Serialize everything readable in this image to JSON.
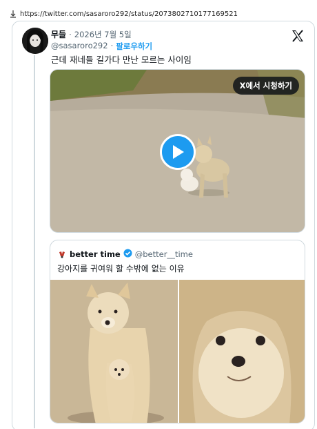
{
  "browser": {
    "url": "https://twitter.com/sasaroro292/status/2073802710177169521"
  },
  "tweet": {
    "display_name": "무들",
    "date": "2026년 7월 5일",
    "handle": "@sasaroro292",
    "follow_label": "팔로우하기",
    "text": "근데 재네들 길가다 만난 모르는 사이임",
    "watch_label": "X에서 시청하기"
  },
  "quote": {
    "display_name": "better time",
    "handle": "@better__time",
    "text": "강아지를 귀여워 할 수밖에 없는 이유"
  },
  "colors": {
    "accent": "#1d9bf0",
    "text": "#0f1419",
    "muted": "#536471",
    "border": "#cfd9de"
  },
  "icons": [
    "download-icon",
    "x-logo-icon",
    "play-icon",
    "verified-badge-icon"
  ]
}
